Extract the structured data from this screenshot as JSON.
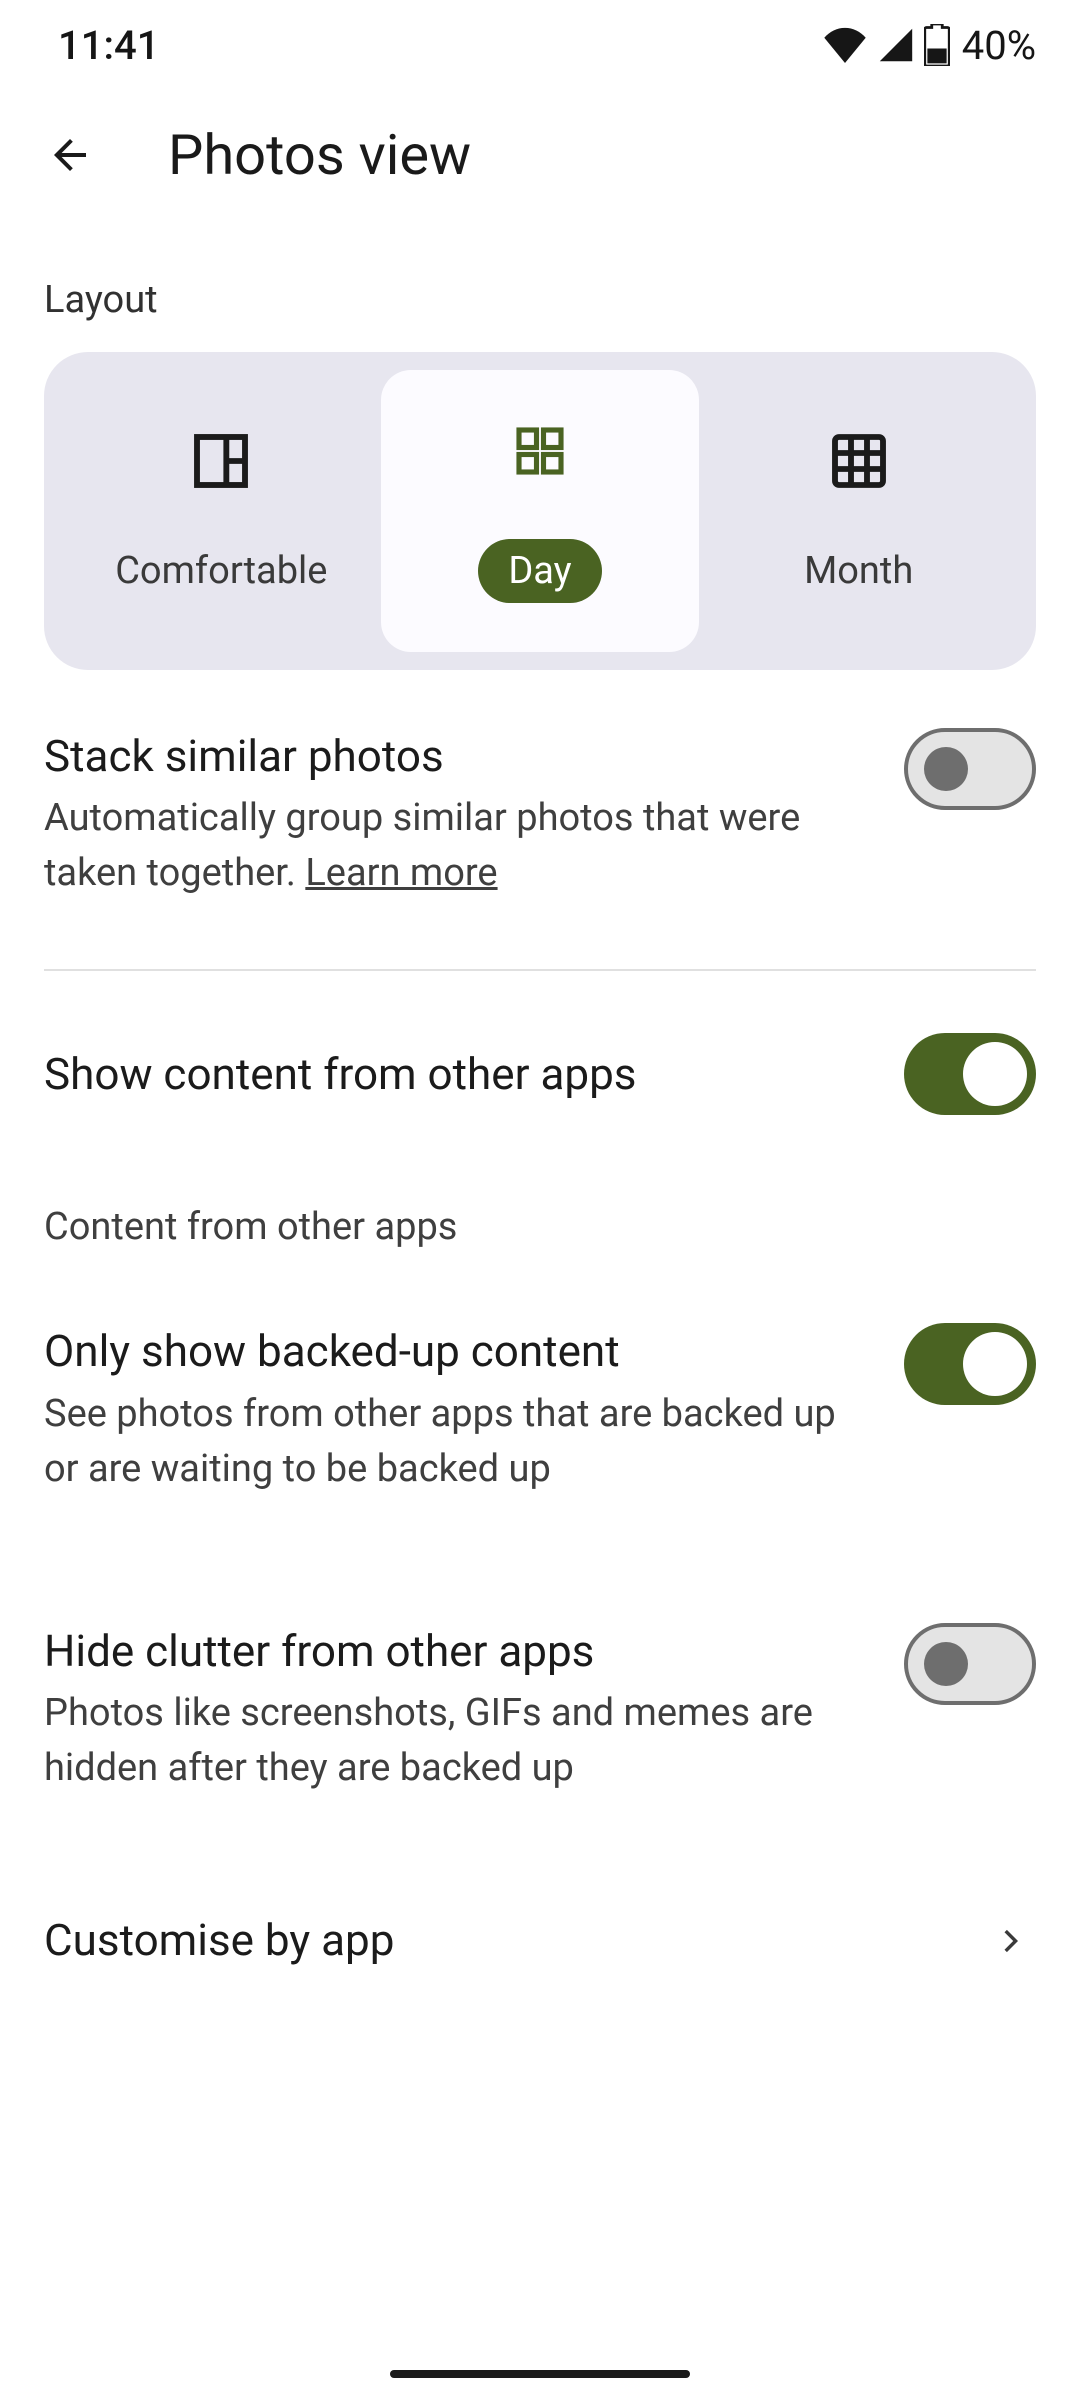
{
  "status": {
    "time": "11:41",
    "battery_text": "40%"
  },
  "header": {
    "title": "Photos view"
  },
  "layout": {
    "label": "Layout",
    "options": {
      "comfortable": "Comfortable",
      "day": "Day",
      "month": "Month"
    },
    "selected": "day"
  },
  "settings": {
    "stack": {
      "title": "Stack similar photos",
      "sub": "Automatically group similar photos that were taken together. ",
      "learn": "Learn more",
      "on": false
    },
    "show_other": {
      "title": "Show content from other apps",
      "on": true
    },
    "content_section": "Content from other apps",
    "only_backed": {
      "title": "Only show backed-up content",
      "sub": "See photos from other apps that are backed up or are waiting to be backed up",
      "on": true
    },
    "hide_clutter": {
      "title": "Hide clutter from other apps",
      "sub": "Photos like screenshots, GIFs and memes are hidden after they are backed up",
      "on": false
    },
    "customise": {
      "title": "Customise by app"
    }
  }
}
